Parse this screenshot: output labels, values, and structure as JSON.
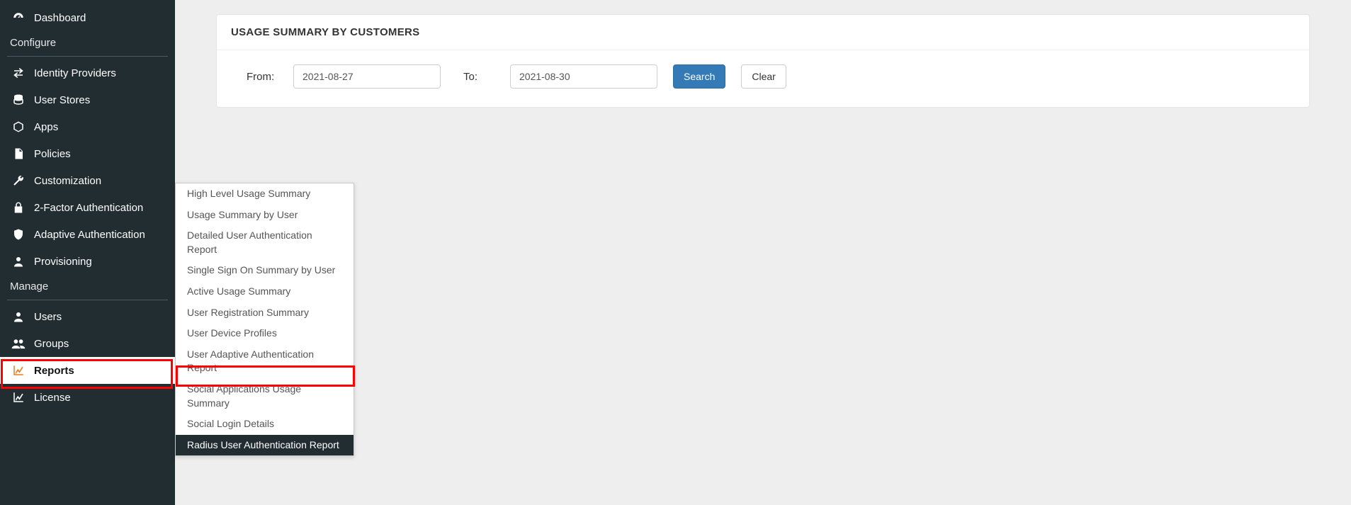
{
  "sidebar": {
    "dashboard": "Dashboard",
    "section_configure": "Configure",
    "identity_providers": "Identity Providers",
    "user_stores": "User Stores",
    "apps": "Apps",
    "policies": "Policies",
    "customization": "Customization",
    "two_factor": "2-Factor Authentication",
    "adaptive_auth": "Adaptive Authentication",
    "provisioning": "Provisioning",
    "section_manage": "Manage",
    "users": "Users",
    "groups": "Groups",
    "reports": "Reports",
    "license": "License"
  },
  "flyout": {
    "items": [
      "High Level Usage Summary",
      "Usage Summary by User",
      "Detailed User Authentication Report",
      "Single Sign On Summary by User",
      "Active Usage Summary",
      "User Registration Summary",
      "User Device Profiles",
      "User Adaptive Authentication Report",
      "Social Applications Usage Summary",
      "Social Login Details",
      "Radius User Authentication Report"
    ],
    "highlight_index": 10
  },
  "panel": {
    "title": "USAGE SUMMARY BY CUSTOMERS",
    "from_label": "From:",
    "to_label": "To:",
    "from_value": "2021-08-27",
    "to_value": "2021-08-30",
    "search_label": "Search",
    "clear_label": "Clear"
  }
}
